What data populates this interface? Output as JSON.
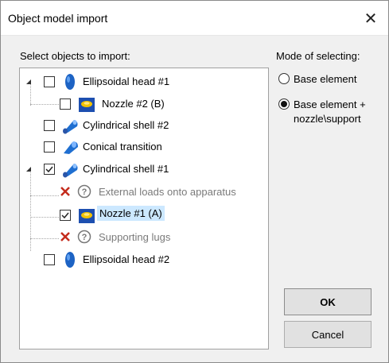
{
  "window": {
    "title": "Object model import"
  },
  "tree_label": "Select objects to import:",
  "mode": {
    "label": "Mode of selecting:",
    "options": [
      {
        "label": "Base element",
        "selected": false
      },
      {
        "label_line1": "Base element +",
        "label_line2": "nozzle\\support",
        "selected": true
      }
    ]
  },
  "tree": {
    "items": [
      {
        "label": "Ellipsoidal head #1",
        "checked": false,
        "expanded": true,
        "icon": "ellipsoidal-head-icon"
      },
      {
        "label": "Nozzle #2 (B)",
        "checked": false,
        "icon": "nozzle-icon"
      },
      {
        "label": "Cylindrical shell #2",
        "checked": false,
        "icon": "cylindrical-shell-icon"
      },
      {
        "label": "Conical transition",
        "checked": false,
        "icon": "conical-transition-icon"
      },
      {
        "label": "Cylindrical shell #1",
        "checked": true,
        "expanded": true,
        "icon": "cylindrical-shell-icon"
      },
      {
        "label": "External loads onto apparatus",
        "status": "unavailable",
        "icon": "question-icon"
      },
      {
        "label": "Nozzle #1 (A)",
        "checked": true,
        "selected": true,
        "icon": "nozzle-icon"
      },
      {
        "label": "Supporting lugs",
        "status": "unavailable",
        "icon": "question-icon"
      },
      {
        "label": "Ellipsoidal head #2",
        "checked": false,
        "icon": "ellipsoidal-head-icon"
      }
    ]
  },
  "buttons": {
    "ok": "OK",
    "cancel": "Cancel"
  },
  "colors": {
    "selection": "#cce8ff",
    "error": "#c42b1c",
    "icon_blue": "#1f6fd1",
    "nozzle_yellow": "#f2c200"
  }
}
